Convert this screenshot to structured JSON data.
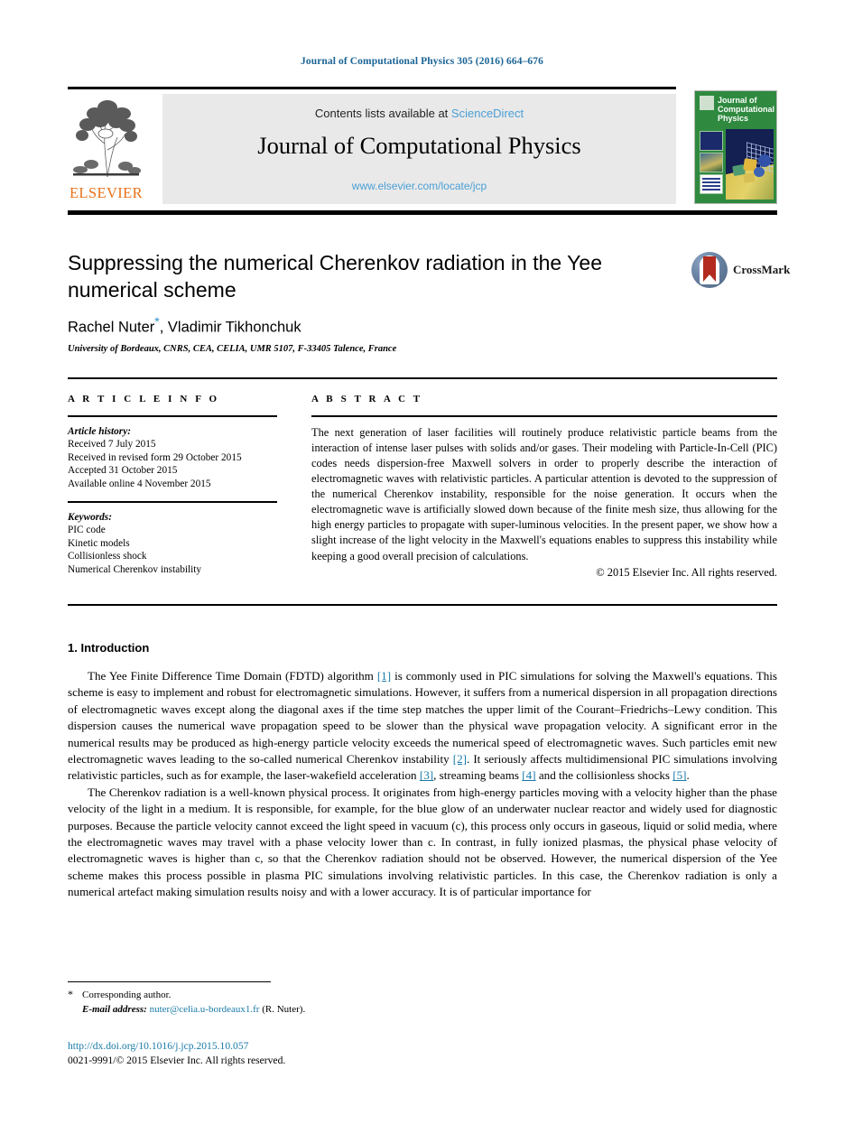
{
  "running_head": "Journal of Computational Physics 305 (2016) 664–676",
  "masthead": {
    "contents_prefix": "Contents lists available at",
    "contents_link": "ScienceDirect",
    "journal_name": "Journal of Computational Physics",
    "journal_url": "www.elsevier.com/locate/jcp",
    "publisher_logo": "ELSEVIER",
    "cover_title": "Journal of Computational Physics",
    "colors": {
      "link": "#4a9fd5",
      "band": "#e9e9e9",
      "elsevier_orange": "#e8711a",
      "cover_green": "#2f8a3f"
    }
  },
  "article": {
    "title": "Suppressing the numerical Cherenkov radiation in the Yee numerical scheme",
    "authors": "Rachel Nuter",
    "authors_rest": ", Vladimir Tikhonchuk",
    "corresponding_marker": "*",
    "affiliation": "University of Bordeaux, CNRS, CEA, CELIA, UMR 5107, F-33405 Talence, France",
    "crossmark_label": "CrossMark"
  },
  "info": {
    "heading": "A R T I C L E   I N F O",
    "history_label": "Article history:",
    "history": [
      "Received 7 July 2015",
      "Received in revised form 29 October 2015",
      "Accepted 31 October 2015",
      "Available online 4 November 2015"
    ],
    "keywords_label": "Keywords:",
    "keywords": [
      "PIC code",
      "Kinetic models",
      "Collisionless shock",
      "Numerical Cherenkov instability"
    ]
  },
  "abstract": {
    "heading": "A B S T R A C T",
    "text": "The next generation of laser facilities will routinely produce relativistic particle beams from the interaction of intense laser pulses with solids and/or gases. Their modeling with Particle-In-Cell (PIC) codes needs dispersion-free Maxwell solvers in order to properly describe the interaction of electromagnetic waves with relativistic particles. A particular attention is devoted to the suppression of the numerical Cherenkov instability, responsible for the noise generation. It occurs when the electromagnetic wave is artificially slowed down because of the finite mesh size, thus allowing for the high energy particles to propagate with super-luminous velocities. In the present paper, we show how a slight increase of the light velocity in the Maxwell's equations enables to suppress this instability while keeping a good overall precision of calculations.",
    "copyright": "© 2015 Elsevier Inc. All rights reserved."
  },
  "introduction": {
    "heading": "1. Introduction",
    "para1_a": "The Yee Finite Difference Time Domain (FDTD) algorithm ",
    "para1_ref1": "[1]",
    "para1_b": " is commonly used in PIC simulations for solving the Maxwell's equations. This scheme is easy to implement and robust for electromagnetic simulations. However, it suffers from a numerical dispersion in all propagation directions of electromagnetic waves except along the diagonal axes if the time step matches the upper limit of the Courant–Friedrichs–Lewy condition. This dispersion causes the numerical wave propagation speed to be slower than the physical wave propagation velocity. A significant error in the numerical results may be produced as high-energy particle velocity exceeds the numerical speed of electromagnetic waves. Such particles emit new electromagnetic waves leading to the so-called numerical Cherenkov instability ",
    "para1_ref2": "[2]",
    "para1_c": ". It seriously affects multidimensional PIC simulations involving relativistic particles, such as for example, the laser-wakefield acceleration ",
    "para1_ref3": "[3]",
    "para1_d": ", streaming beams ",
    "para1_ref4": "[4]",
    "para1_e": " and the collisionless shocks ",
    "para1_ref5": "[5]",
    "para1_f": ".",
    "para2": "The Cherenkov radiation is a well-known physical process. It originates from high-energy particles moving with a velocity higher than the phase velocity of the light in a medium. It is responsible, for example, for the blue glow of an underwater nuclear reactor and widely used for diagnostic purposes. Because the particle velocity cannot exceed the light speed in vacuum (c), this process only occurs in gaseous, liquid or solid media, where the electromagnetic waves may travel with a phase velocity lower than c. In contrast, in fully ionized plasmas, the physical phase velocity of electromagnetic waves is higher than c, so that the Cherenkov radiation should not be observed. However, the numerical dispersion of the Yee scheme makes this process possible in plasma PIC simulations involving relativistic particles. In this case, the Cherenkov radiation is only a numerical artefact making simulation results noisy and with a lower accuracy. It is of particular importance for"
  },
  "footer": {
    "corresponding": "Corresponding author.",
    "email_label": "E-mail address:",
    "email": "nuter@celia.u-bordeaux1.fr",
    "email_suffix": " (R. Nuter).",
    "doi": "http://dx.doi.org/10.1016/j.jcp.2015.10.057",
    "issn": "0021-9991/© 2015 Elsevier Inc. All rights reserved."
  }
}
